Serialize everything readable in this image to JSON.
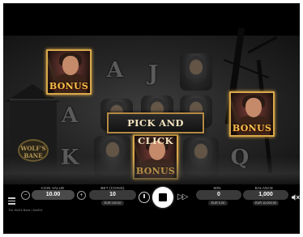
{
  "game": {
    "title": "The Wolf's Bane",
    "provider": "NetEnt",
    "footer_text": "The Wolf's Bane | NetEnt"
  },
  "reels": {
    "tavern_sign": "WOLF'S BANE",
    "letter_symbols": [
      "A",
      "J",
      "A",
      "K",
      "Q"
    ],
    "bonus_label": "BONUS",
    "banner": "PICK AND CLICK"
  },
  "controls": {
    "coin_value": {
      "label": "COIN VALUE",
      "value": "10.00",
      "minus": "−",
      "plus": "+"
    },
    "bet": {
      "label": "BET (COINS)",
      "value": "10",
      "sub": "EUR 100.00"
    },
    "win": {
      "label": "WIN",
      "value": "0",
      "sub": "EUR 0.00"
    },
    "balance": {
      "label": "BALANCE",
      "value": "1,000",
      "sub": "EUR 10,000.00"
    },
    "fast_play_icon": "double-play-icon",
    "sound_icon": "muted-speaker-icon"
  },
  "colors": {
    "bonus_gold": "#f6c24b",
    "banner_border": "#b58a44",
    "background": "#000000"
  }
}
